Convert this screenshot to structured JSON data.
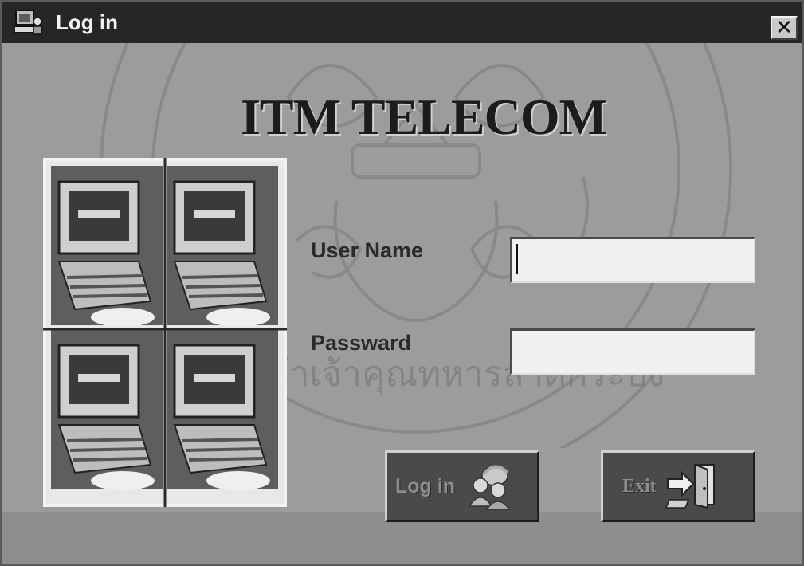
{
  "window": {
    "title": "Log in",
    "title_icon": "computer-users-icon",
    "close_label": "✕"
  },
  "app": {
    "title": "ITM TELECOM"
  },
  "form": {
    "username_label": "User Name",
    "username_value": "",
    "password_label": "Passward",
    "password_value": ""
  },
  "buttons": {
    "login_label": "Log in",
    "login_icon": "users-icon",
    "exit_label": "Exit",
    "exit_icon": "exit-door-icon"
  },
  "watermark_text": "จอมเกล้าเจ้าคุณทหารลาดกระบัง",
  "colors": {
    "titlebar": "#262626",
    "background": "#9c9c9c",
    "button": "#4a4a4a"
  }
}
